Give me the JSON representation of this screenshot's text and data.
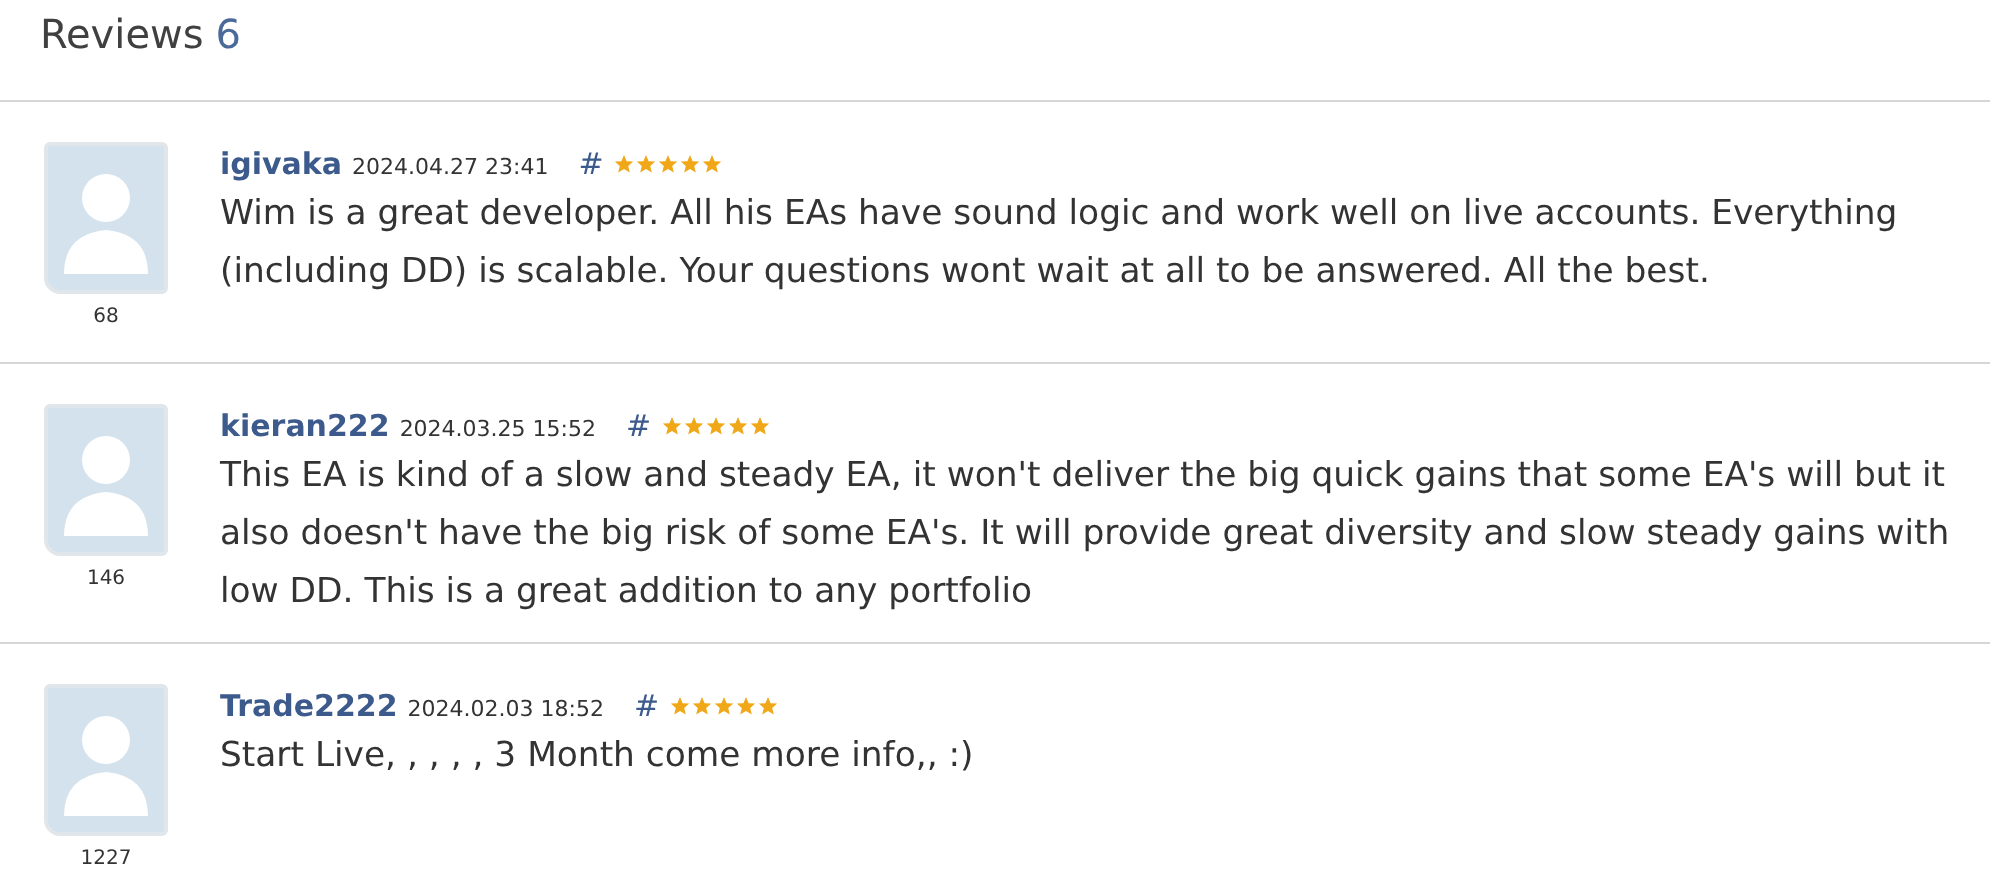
{
  "heading": {
    "title": "Reviews",
    "count": "6"
  },
  "reviews": [
    {
      "author": "igivaka",
      "date": "2024.04.27 23:41",
      "anchor": "#",
      "stars": 5,
      "author_rating": "68",
      "text": "Wim is a great developer. All his EAs have sound logic and work well on live accounts. Everything (including DD) is scalable. Your questions wont wait at all to be answered. All the best."
    },
    {
      "author": "kieran222",
      "date": "2024.03.25 15:52",
      "anchor": "#",
      "stars": 5,
      "author_rating": "146",
      "text": "This EA is kind of a slow and steady EA, it won't deliver the big quick gains that some EA's will but it also doesn't have the big risk of some EA's. It will provide great diversity and slow steady gains with low DD. This is a great addition to any portfolio"
    },
    {
      "author": "Trade2222",
      "date": "2024.02.03 18:52",
      "anchor": "#",
      "stars": 5,
      "author_rating": "1227",
      "text": "Start Live, , , , , 3 Month come more info,, :)"
    }
  ]
}
